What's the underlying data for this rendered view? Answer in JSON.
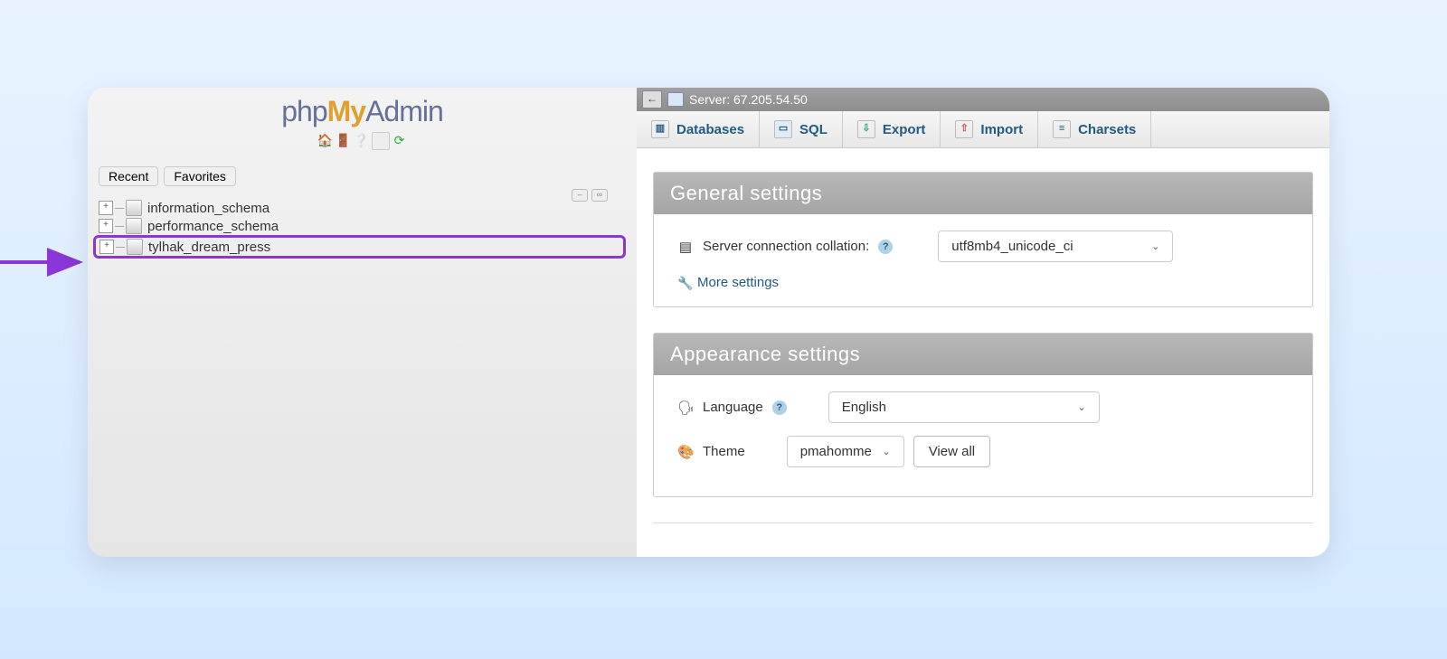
{
  "sidebar": {
    "logo": {
      "php": "php",
      "my": "My",
      "admin": "Admin"
    },
    "toolbar_icons": [
      "home",
      "exit",
      "help",
      "sql",
      "refresh"
    ],
    "tabs": {
      "recent": "Recent",
      "favorites": "Favorites"
    },
    "databases": [
      {
        "name": "information_schema",
        "highlighted": false
      },
      {
        "name": "performance_schema",
        "highlighted": false
      },
      {
        "name": "tylhak_dream_press",
        "highlighted": true
      }
    ]
  },
  "topbar": {
    "server_label": "Server:",
    "server_addr": "67.205.54.50"
  },
  "nav": [
    {
      "label": "Databases",
      "icon": "db"
    },
    {
      "label": "SQL",
      "icon": "sql"
    },
    {
      "label": "Export",
      "icon": "export"
    },
    {
      "label": "Import",
      "icon": "import"
    },
    {
      "label": "Charsets",
      "icon": "char"
    }
  ],
  "general": {
    "title": "General settings",
    "collation_label": "Server connection collation:",
    "collation_value": "utf8mb4_unicode_ci",
    "more": "More settings"
  },
  "appearance": {
    "title": "Appearance settings",
    "language_label": "Language",
    "language_value": "English",
    "theme_label": "Theme",
    "theme_value": "pmahomme",
    "view_all": "View all"
  },
  "annotation": {
    "color": "#8b36d6"
  }
}
